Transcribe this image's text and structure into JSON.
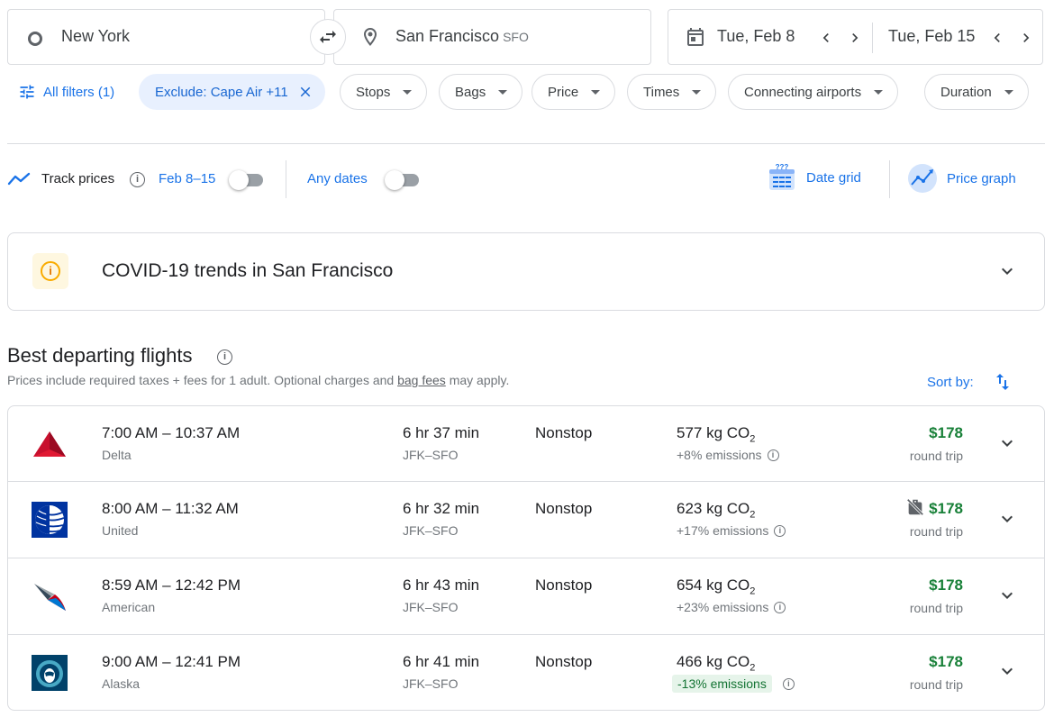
{
  "search": {
    "origin": "New York",
    "destination": "San Francisco",
    "destination_code": "SFO",
    "depart_date": "Tue, Feb 8",
    "return_date": "Tue, Feb 15"
  },
  "filters": {
    "all_filters": "All filters (1)",
    "exclude_chip": "Exclude: Cape Air +11",
    "chips": [
      "Stops",
      "Bags",
      "Price",
      "Times",
      "Connecting airports",
      "Duration"
    ]
  },
  "tracking": {
    "track_prices": "Track prices",
    "date_range": "Feb 8–15",
    "any_dates": "Any dates",
    "date_grid": "Date grid",
    "price_graph": "Price graph"
  },
  "covid": {
    "title": "COVID-19 trends in San Francisco"
  },
  "results": {
    "heading": "Best departing flights",
    "note_prefix": "Prices include required taxes + fees for 1 adult. Optional charges and ",
    "note_link": "bag fees",
    "note_suffix": " may apply.",
    "sort_by": "Sort by:",
    "flights": [
      {
        "time": "7:00 AM – 10:37 AM",
        "airline": "Delta",
        "duration": "6 hr 37 min",
        "route": "JFK–SFO",
        "stops": "Nonstop",
        "co2": "577 kg CO",
        "emissions": "+8% emissions",
        "price": "$178",
        "trip": "round trip"
      },
      {
        "time": "8:00 AM – 11:32 AM",
        "airline": "United",
        "duration": "6 hr 32 min",
        "route": "JFK–SFO",
        "stops": "Nonstop",
        "co2": "623 kg CO",
        "emissions": "+17% emissions",
        "price": "$178",
        "trip": "round trip"
      },
      {
        "time": "8:59 AM – 12:42 PM",
        "airline": "American",
        "duration": "6 hr 43 min",
        "route": "JFK–SFO",
        "stops": "Nonstop",
        "co2": "654 kg CO",
        "emissions": "+23% emissions",
        "price": "$178",
        "trip": "round trip"
      },
      {
        "time": "9:00 AM – 12:41 PM",
        "airline": "Alaska",
        "duration": "6 hr 41 min",
        "route": "JFK–SFO",
        "stops": "Nonstop",
        "co2": "466 kg CO",
        "emissions": "-13% emissions",
        "price": "$178",
        "trip": "round trip"
      }
    ]
  },
  "colors": {
    "accent": "#1a73e8",
    "price_green": "#188038",
    "chip_active_bg": "#e8f0fe",
    "delta_red": "#c8102e",
    "united_blue": "#0033a0",
    "alaska_navy": "#01426a"
  }
}
